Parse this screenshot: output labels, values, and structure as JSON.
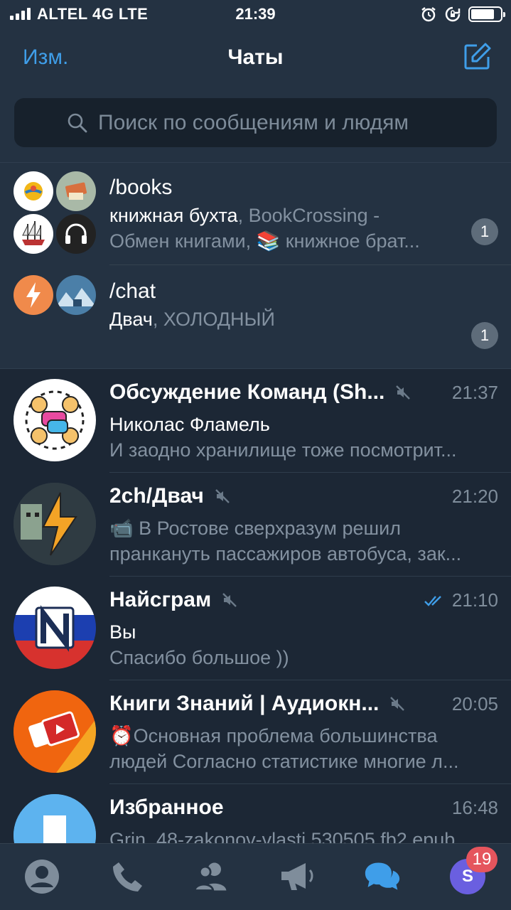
{
  "status_bar": {
    "carrier": "ALTEL 4G LTE",
    "time": "21:39",
    "battery_level": 0.8
  },
  "header": {
    "edit_label": "Изм.",
    "title": "Чаты",
    "compose_icon": "compose-icon"
  },
  "search": {
    "placeholder": "Поиск по сообщениям и людям"
  },
  "folders": [
    {
      "name": "/books",
      "line1_highlight": "книжная бухта",
      "line1_rest": ", BookCrossing -",
      "line2": "Обмен книгами, 📚 книжное брат...",
      "unread": "1"
    },
    {
      "name": "/chat",
      "line1_highlight": "Двач",
      "line1_rest": ", ХОЛОДНЫЙ",
      "unread": "1"
    }
  ],
  "chats": [
    {
      "name": "Обсуждение Команд (Sh...",
      "muted": true,
      "time": "21:37",
      "sender": "Николас Фламель",
      "preview": "И заодно хранилище тоже посмотрит..."
    },
    {
      "name": "2ch/Двач",
      "muted": true,
      "time": "21:20",
      "line1": "📹 В Ростове сверхразум решил",
      "line2": "пранкануть пассажиров автобуса, зак..."
    },
    {
      "name": "Найсграм",
      "muted": true,
      "read_status": "double-check-icon",
      "time": "21:10",
      "sender": "Вы",
      "preview": "Спасибо большое ))"
    },
    {
      "name": "Книги Знаний | Аудиокн...",
      "muted": true,
      "time": "20:05",
      "line1": "⏰Основная проблема большинства",
      "line2": "людей Согласно статистике многие л..."
    },
    {
      "name": "Избранное",
      "muted": false,
      "time": "16:48",
      "line1": "Grin_48-zakonov-vlasti.530505.fb2.epub"
    }
  ],
  "tabbar": {
    "tabs": [
      "contacts-icon",
      "calls-icon",
      "groups-icon",
      "channels-icon",
      "chats-icon",
      "profile-avatar"
    ],
    "profile_initial": "S",
    "badge": "19"
  },
  "colors": {
    "accent": "#3f9ee9",
    "background": "#1c2735",
    "header": "#243242",
    "badge": "#e5555d"
  }
}
